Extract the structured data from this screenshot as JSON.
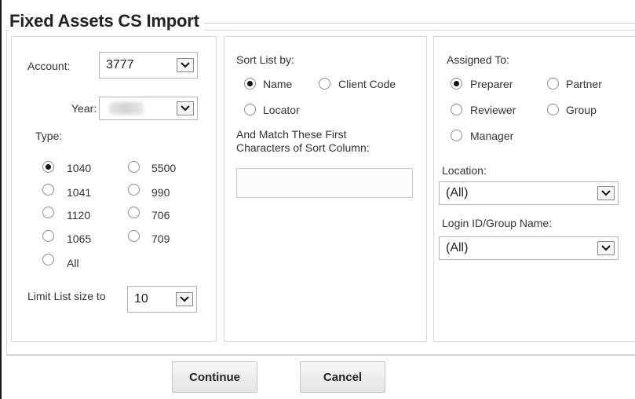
{
  "title": "Fixed Assets CS Import",
  "left_panel": {
    "account_label": "Account:",
    "account_value": "3777",
    "year_label": "Year:",
    "year_value": "",
    "type_label": "Type:",
    "types": [
      {
        "label": "1040",
        "selected": true
      },
      {
        "label": "5500",
        "selected": false
      },
      {
        "label": "1041",
        "selected": false
      },
      {
        "label": "990",
        "selected": false
      },
      {
        "label": "1120",
        "selected": false
      },
      {
        "label": "706",
        "selected": false
      },
      {
        "label": "1065",
        "selected": false
      },
      {
        "label": "709",
        "selected": false
      },
      {
        "label": "All",
        "selected": false
      }
    ],
    "limit_label": "Limit List size to",
    "limit_value": "10"
  },
  "middle_panel": {
    "sort_label": "Sort List by:",
    "sort_options": [
      {
        "label": "Name",
        "selected": true
      },
      {
        "label": "Client Code",
        "selected": false
      },
      {
        "label": "Locator",
        "selected": false
      }
    ],
    "match_label_line1": "And Match These First",
    "match_label_line2": "Characters of Sort Column:",
    "match_value": ""
  },
  "right_panel": {
    "assigned_label": "Assigned To:",
    "assigned_options": [
      {
        "label": "Preparer",
        "selected": true
      },
      {
        "label": "Partner",
        "selected": false
      },
      {
        "label": "Reviewer",
        "selected": false
      },
      {
        "label": "Group",
        "selected": false
      },
      {
        "label": "Manager",
        "selected": false
      }
    ],
    "location_label": "Location:",
    "location_value": "(All)",
    "login_label": "Login ID/Group Name:",
    "login_value": "(All)"
  },
  "buttons": {
    "continue": "Continue",
    "cancel": "Cancel"
  },
  "icons": {
    "dropdown": "chevron-down-icon",
    "radio": "radio-icon"
  }
}
